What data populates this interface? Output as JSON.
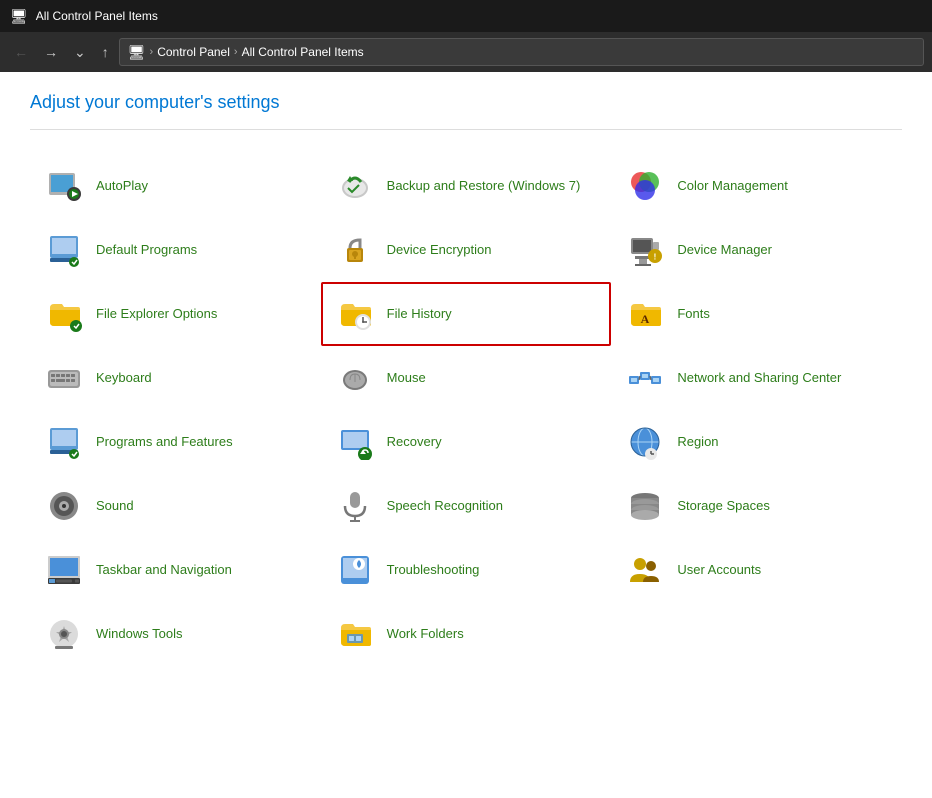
{
  "titleBar": {
    "icon": "🖥",
    "title": "All Control Panel Items"
  },
  "navBar": {
    "breadcrumb": {
      "icon": "🖥",
      "parts": [
        "Control Panel",
        "All Control Panel Items"
      ]
    }
  },
  "pageTitle": "Adjust your computer's settings",
  "items": [
    {
      "id": "autoplay",
      "label": "AutoPlay",
      "highlighted": false
    },
    {
      "id": "backup-restore",
      "label": "Backup and Restore (Windows 7)",
      "highlighted": false
    },
    {
      "id": "color-management",
      "label": "Color Management",
      "highlighted": false
    },
    {
      "id": "default-programs",
      "label": "Default Programs",
      "highlighted": false
    },
    {
      "id": "device-encryption",
      "label": "Device Encryption",
      "highlighted": false
    },
    {
      "id": "device-manager",
      "label": "Device Manager",
      "highlighted": false
    },
    {
      "id": "file-explorer-options",
      "label": "File Explorer Options",
      "highlighted": false
    },
    {
      "id": "file-history",
      "label": "File History",
      "highlighted": true
    },
    {
      "id": "fonts",
      "label": "Fonts",
      "highlighted": false
    },
    {
      "id": "keyboard",
      "label": "Keyboard",
      "highlighted": false
    },
    {
      "id": "mouse",
      "label": "Mouse",
      "highlighted": false
    },
    {
      "id": "network-sharing",
      "label": "Network and Sharing Center",
      "highlighted": false
    },
    {
      "id": "programs-features",
      "label": "Programs and Features",
      "highlighted": false
    },
    {
      "id": "recovery",
      "label": "Recovery",
      "highlighted": false
    },
    {
      "id": "region",
      "label": "Region",
      "highlighted": false
    },
    {
      "id": "sound",
      "label": "Sound",
      "highlighted": false
    },
    {
      "id": "speech-recognition",
      "label": "Speech Recognition",
      "highlighted": false
    },
    {
      "id": "storage-spaces",
      "label": "Storage Spaces",
      "highlighted": false
    },
    {
      "id": "taskbar-navigation",
      "label": "Taskbar and Navigation",
      "highlighted": false
    },
    {
      "id": "troubleshooting",
      "label": "Troubleshooting",
      "highlighted": false
    },
    {
      "id": "user-accounts",
      "label": "User Accounts",
      "highlighted": false
    },
    {
      "id": "windows-tools",
      "label": "Windows Tools",
      "highlighted": false
    },
    {
      "id": "work-folders",
      "label": "Work Folders",
      "highlighted": false
    }
  ]
}
